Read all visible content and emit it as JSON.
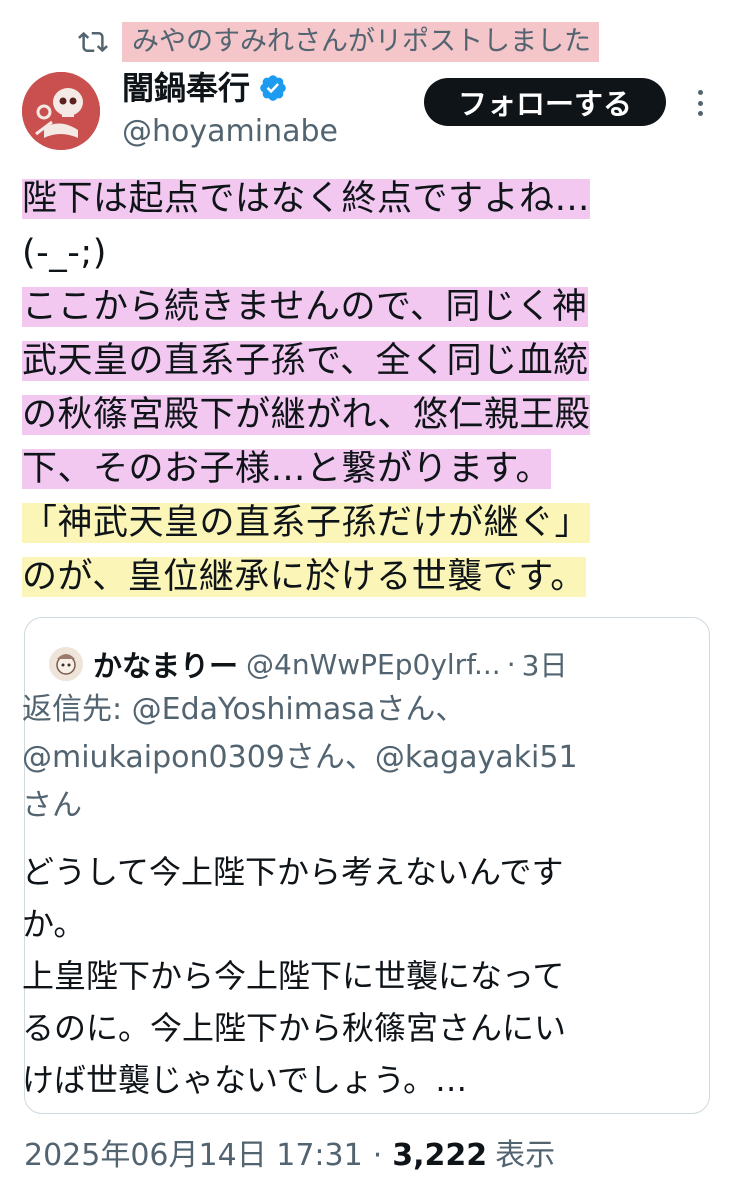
{
  "repost": {
    "text": "みやのすみれさんがリポストしました"
  },
  "author": {
    "name": "闇鍋奉行",
    "handle": "@hoyaminabe",
    "follow_label": "フォローする"
  },
  "tweet": {
    "lines": [
      "陛下は起点ではなく終点ですよね…",
      "(-_-;)",
      "ここから続きませんので、同じく神",
      "武天皇の直系子孫で、全く同じ血統",
      "の秋篠宮殿下が継がれ、悠仁親王殿",
      "下、そのお子様…と繋がります。",
      "「神武天皇の直系子孫だけが継ぐ」",
      "のが、皇位継承に於ける世襲です。"
    ]
  },
  "quote": {
    "name": "かなまりー",
    "handle": "@4nWwPEp0ylrf...",
    "separator": "·",
    "date": "3日",
    "reply_lines": [
      "返信先: @EdaYoshimasaさん、",
      "@miukaipon0309さん、@kagayaki51",
      "さん"
    ],
    "text_lines": [
      "どうして今上陛下から考えないんです",
      "か。",
      "上皇陛下から今上陛下に世襲になって",
      "るのに。今上陛下から秋篠宮さんにい",
      "けば世襲じゃないでしょう。…"
    ]
  },
  "footer": {
    "timestamp": "2025年06月14日 17:31",
    "separator": "·",
    "views_count": "3,222",
    "views_label": "表示"
  },
  "colors": {
    "highlight_pink": "#f2c8f0",
    "highlight_yellow": "#fbf6b8",
    "repost_highlight": "#f4c5c9",
    "verified_blue": "#1d9bf0"
  }
}
